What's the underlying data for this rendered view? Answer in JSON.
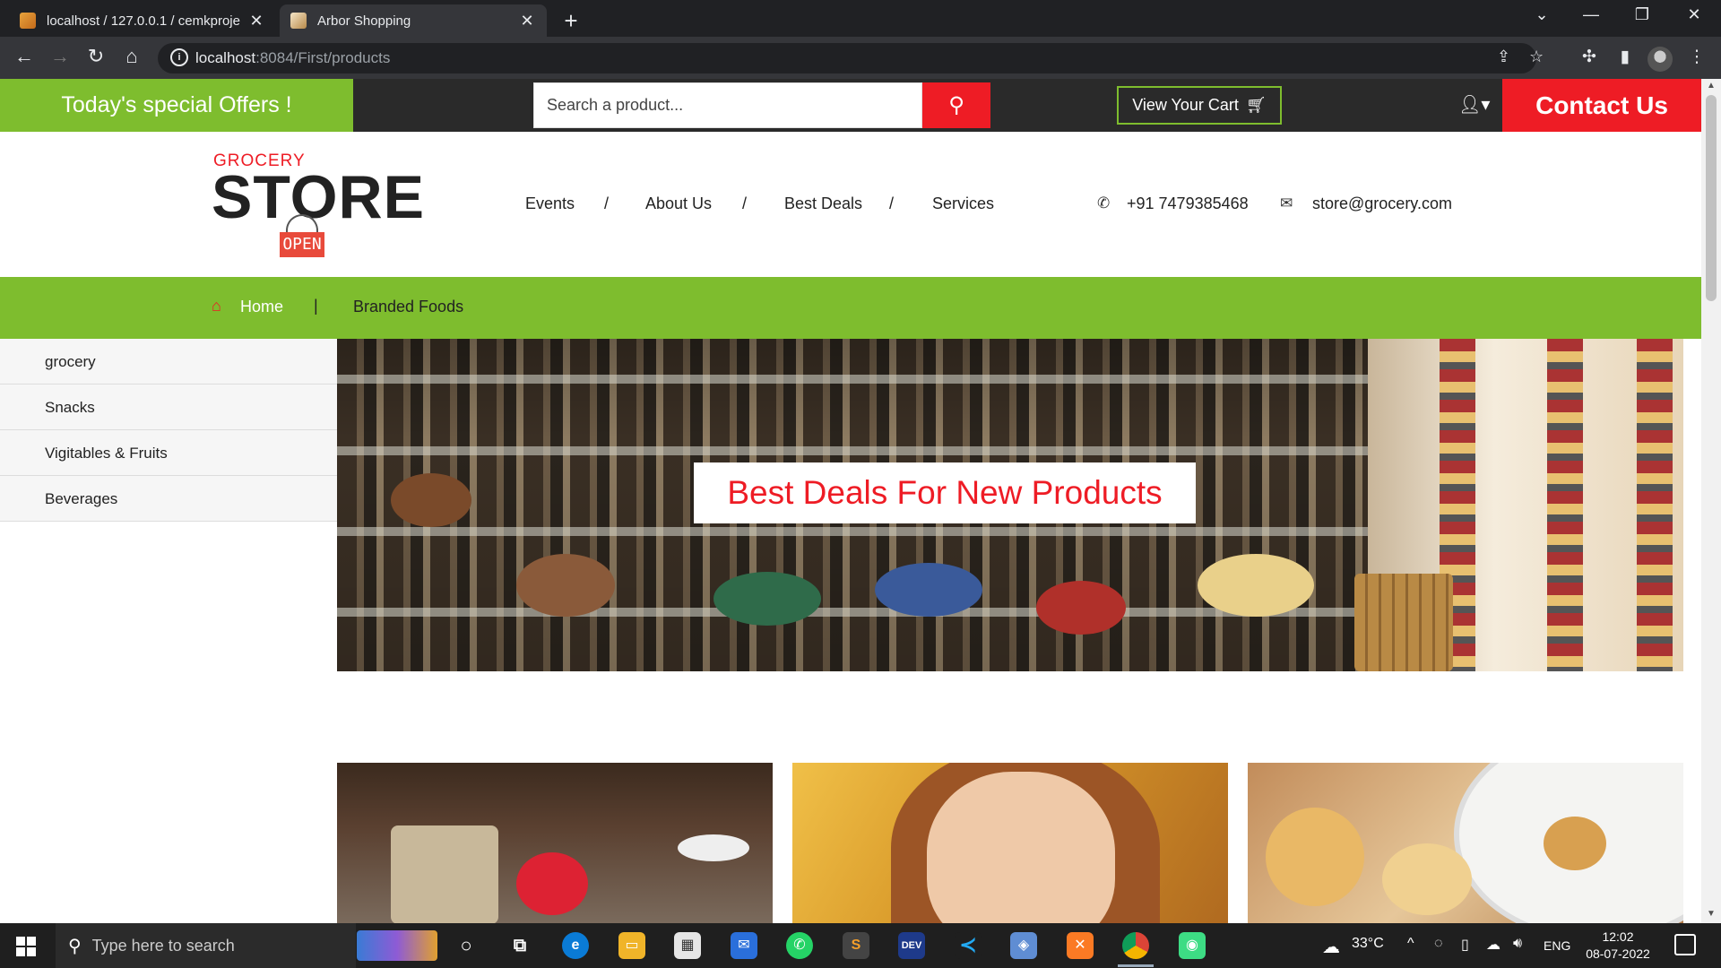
{
  "browser": {
    "tabs": [
      {
        "title": "localhost / 127.0.0.1 / cemkproje",
        "active": false
      },
      {
        "title": "Arbor Shopping",
        "active": true
      }
    ],
    "url_host": "localhost",
    "url_rest": ":8084/First/products"
  },
  "topbar": {
    "offers": "Today's special Offers !",
    "search_placeholder": "Search a product...",
    "cart_label": "View Your Cart",
    "contact_label": "Contact Us"
  },
  "logo": {
    "small": "GROCERY",
    "big": "STORE",
    "sign": "OPEN"
  },
  "header_nav": {
    "items": [
      "Events",
      "About Us",
      "Best Deals",
      "Services"
    ],
    "separator": "/",
    "phone": "+91 7479385468",
    "email": "store@grocery.com"
  },
  "breadcrumb": {
    "home": "Home",
    "separator": "|",
    "current": "Branded Foods"
  },
  "sidebar": {
    "items": [
      "grocery",
      "Snacks",
      "Vigitables & Fruits",
      "Beverages"
    ]
  },
  "hero": {
    "label": "Best Deals For New Products"
  },
  "taskbar": {
    "search_text": "Type here to search",
    "weather": "33°C",
    "lang": "ENG",
    "time": "12:02",
    "date": "08-07-2022",
    "dev_label": "DEV"
  },
  "colors": {
    "green": "#7ebd2e",
    "red": "#ee1c25",
    "dark": "#2a2a2a"
  }
}
